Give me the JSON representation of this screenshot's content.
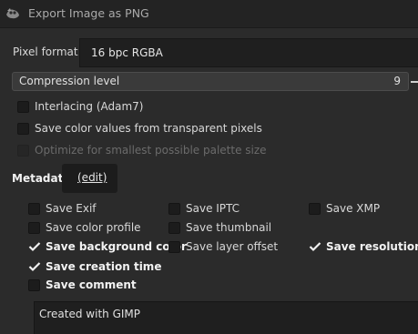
{
  "window": {
    "title": "Export Image as PNG",
    "icon": "gimp-wilber-icon"
  },
  "pixel_format": {
    "label": "Pixel format",
    "value": "16 bpc RGBA"
  },
  "compression": {
    "label": "Compression level",
    "value": "9"
  },
  "options": {
    "interlacing": {
      "label": "Interlacing (Adam7)",
      "checked": false
    },
    "transparent": {
      "label": "Save color values from transparent pixels",
      "checked": false
    },
    "optimize": {
      "label": "Optimize for smallest possible palette size",
      "checked": false,
      "disabled": true
    }
  },
  "metadata": {
    "label": "Metadata",
    "edit_label": "(edit)",
    "items": {
      "exif": {
        "label": "Save Exif",
        "checked": false
      },
      "iptc": {
        "label": "Save IPTC",
        "checked": false
      },
      "xmp": {
        "label": "Save XMP",
        "checked": false
      },
      "color_profile": {
        "label": "Save color profile",
        "checked": false
      },
      "thumbnail": {
        "label": "Save thumbnail",
        "checked": false
      },
      "bg_color": {
        "label": "Save background color",
        "checked": true
      },
      "layer_offset": {
        "label": "Save layer offset",
        "checked": false
      },
      "resolution": {
        "label": "Save resolution",
        "checked": true
      },
      "creation_time": {
        "label": "Save creation time",
        "checked": true
      },
      "comment": {
        "label": "Save comment",
        "checked": false
      }
    },
    "comment_text": "Created with GIMP"
  },
  "colors": {
    "background": "#2b2b2b",
    "field": "#1f1f1f",
    "text": "#d8d8d8"
  }
}
